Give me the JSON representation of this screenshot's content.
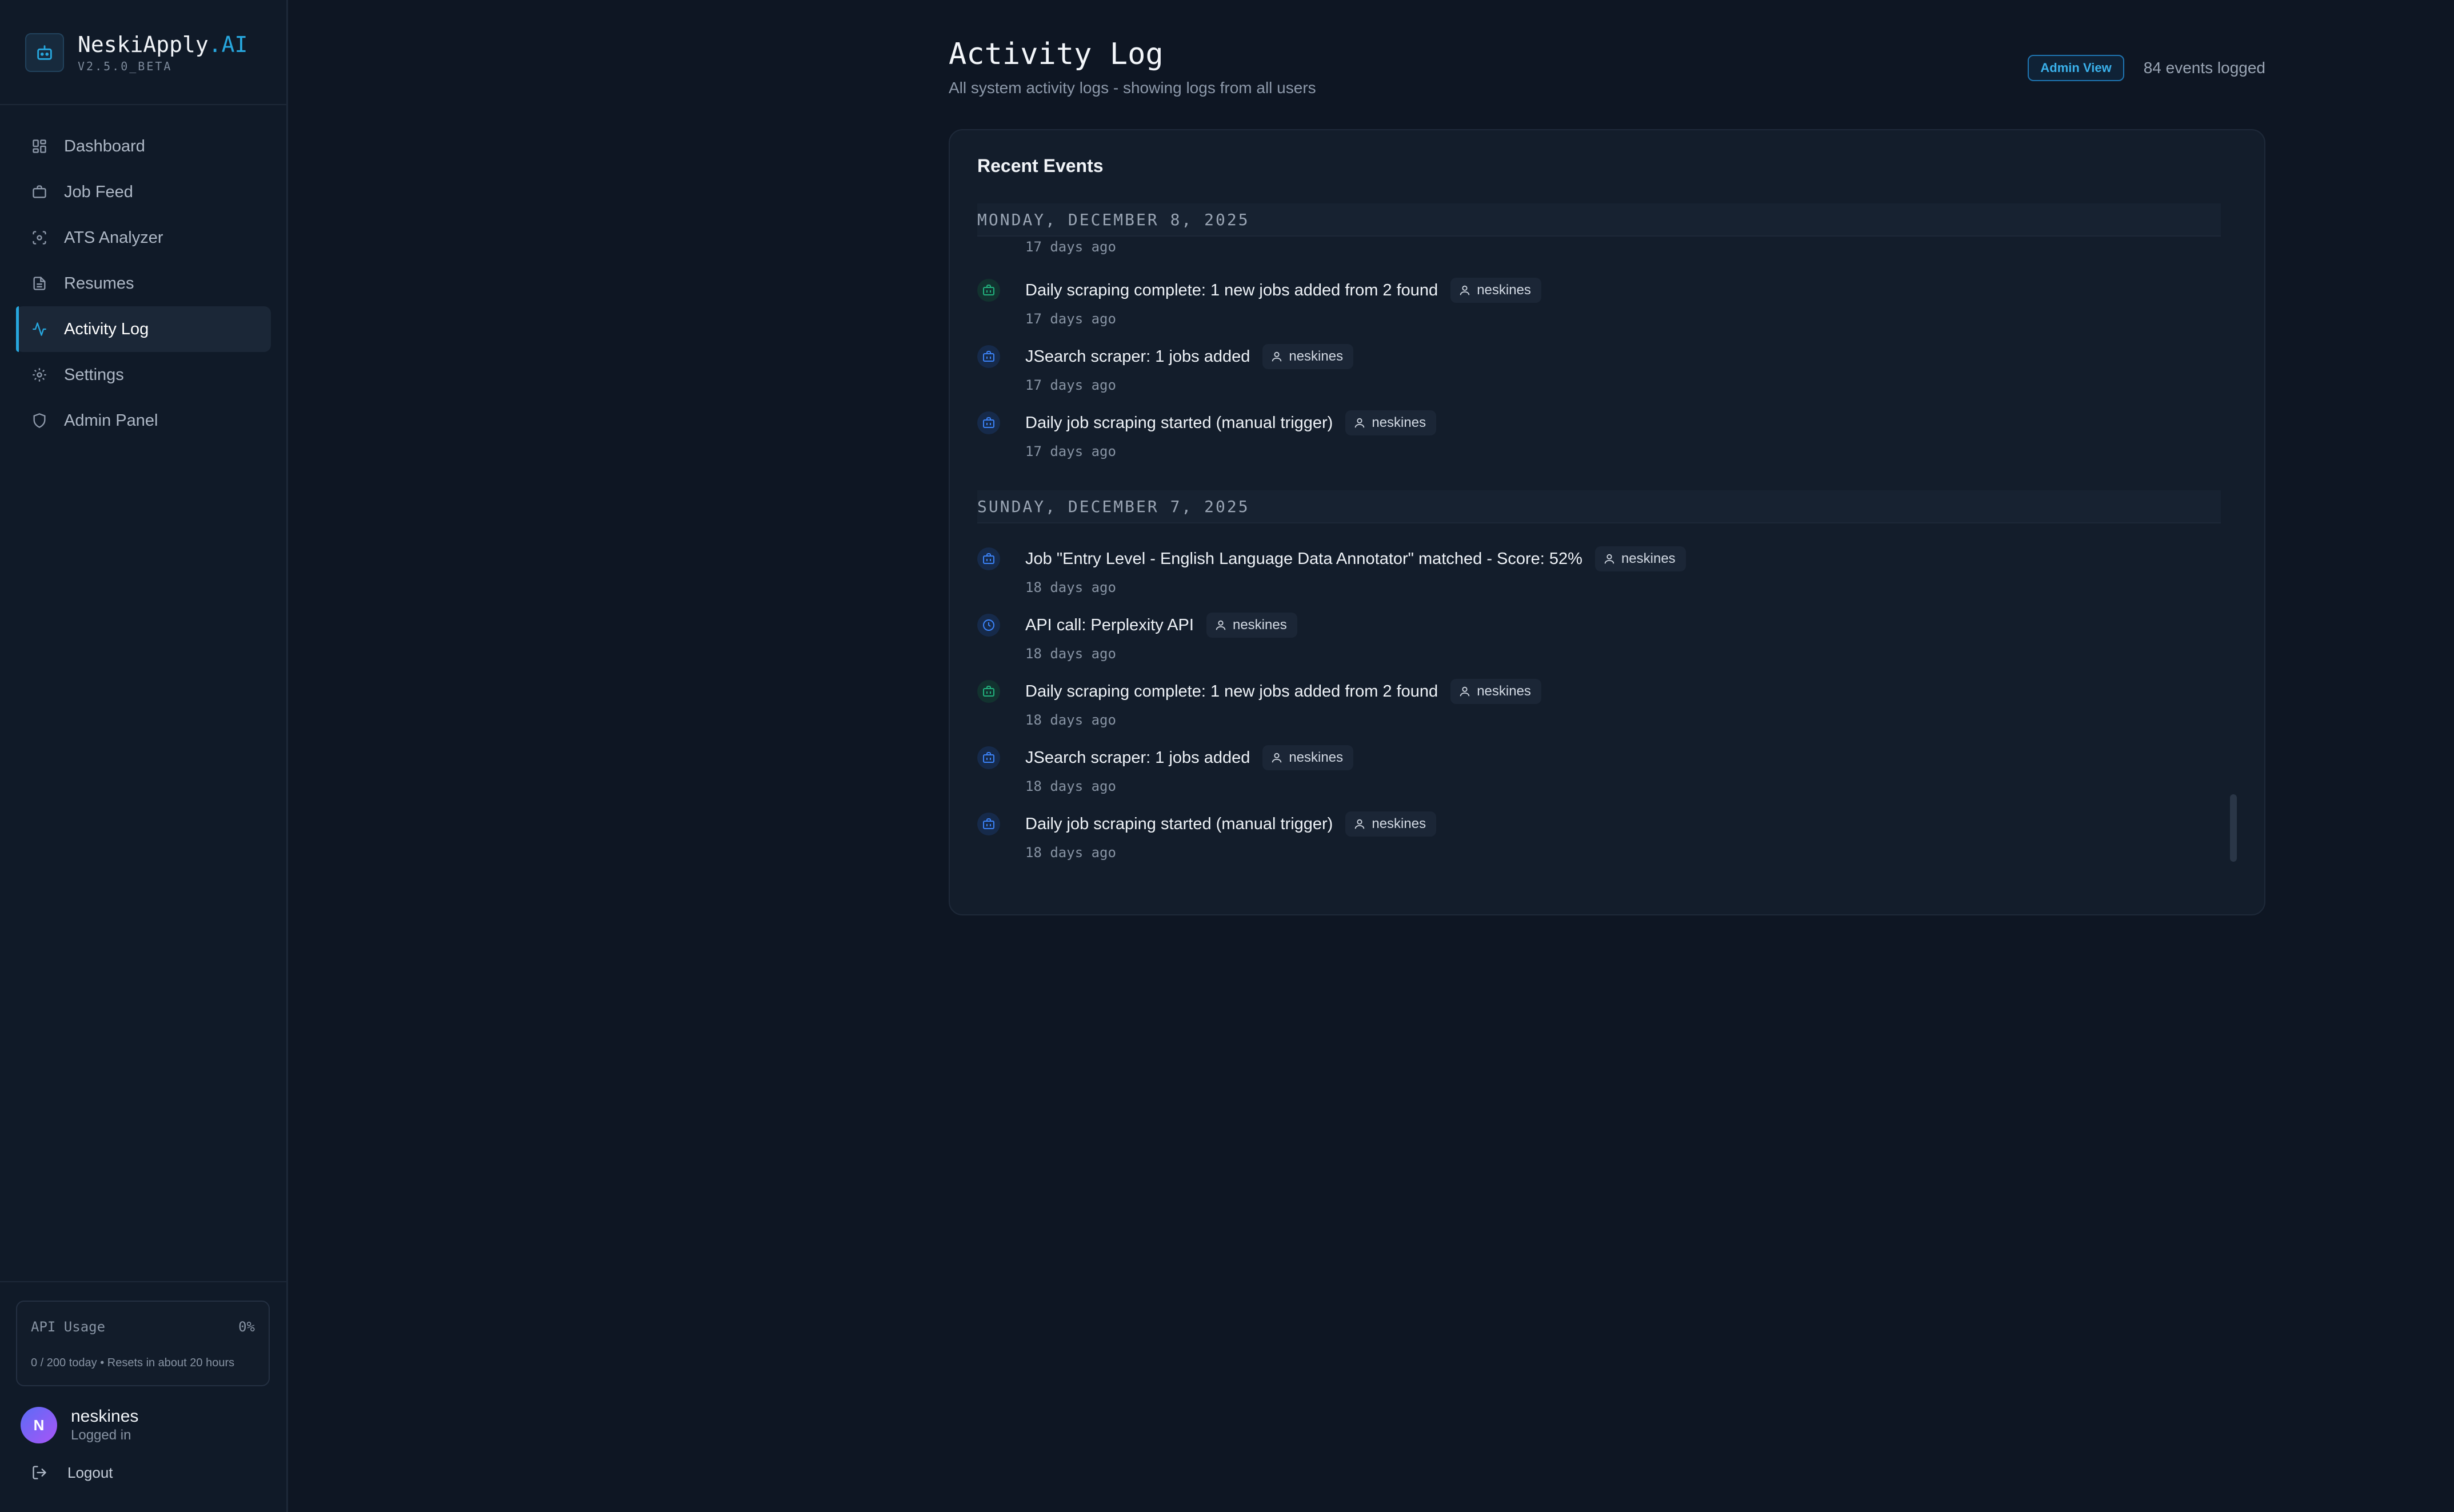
{
  "brand": {
    "name": "NeskiApply",
    "suffix": ".AI",
    "version": "V2.5.0_BETA"
  },
  "nav": [
    {
      "label": "Dashboard",
      "icon": "dashboard-icon"
    },
    {
      "label": "Job Feed",
      "icon": "briefcase-icon"
    },
    {
      "label": "ATS Analyzer",
      "icon": "scan-icon"
    },
    {
      "label": "Resumes",
      "icon": "document-icon"
    },
    {
      "label": "Activity Log",
      "icon": "activity-icon",
      "active": true
    },
    {
      "label": "Settings",
      "icon": "gear-icon"
    },
    {
      "label": "Admin Panel",
      "icon": "shield-icon"
    }
  ],
  "usage": {
    "title": "API Usage",
    "percent": "0%",
    "detail": "0 / 200 today • Resets in about 20 hours"
  },
  "user": {
    "initial": "N",
    "name": "neskines",
    "status": "Logged in"
  },
  "logout_label": "Logout",
  "header": {
    "title": "Activity Log",
    "subtitle": "All system activity logs - showing logs from all users",
    "badge": "Admin View",
    "count": "84 events logged"
  },
  "card": {
    "title": "Recent Events",
    "groups": [
      {
        "date": "MONDAY, DECEMBER 8, 2025",
        "leading_time": "17 days ago",
        "events": [
          {
            "title": "Daily scraping complete: 1 new jobs added from 2 found",
            "user": "neskines",
            "time": "17 days ago",
            "icon": "briefcase-icon",
            "color": "#22b07d"
          },
          {
            "title": "JSearch scraper: 1 jobs added",
            "user": "neskines",
            "time": "17 days ago",
            "icon": "briefcase-icon",
            "color": "#3b82f6"
          },
          {
            "title": "Daily job scraping started (manual trigger)",
            "user": "neskines",
            "time": "17 days ago",
            "icon": "briefcase-icon",
            "color": "#3b82f6"
          }
        ]
      },
      {
        "date": "SUNDAY, DECEMBER 7, 2025",
        "events": [
          {
            "title": "Job \"Entry Level - English Language Data Annotator\" matched - Score: 52%",
            "user": "neskines",
            "time": "18 days ago",
            "icon": "briefcase-icon",
            "color": "#3b82f6"
          },
          {
            "title": "API call: Perplexity API",
            "user": "neskines",
            "time": "18 days ago",
            "icon": "clock-icon",
            "color": "#3b82f6"
          },
          {
            "title": "Daily scraping complete: 1 new jobs added from 2 found",
            "user": "neskines",
            "time": "18 days ago",
            "icon": "briefcase-icon",
            "color": "#22b07d"
          },
          {
            "title": "JSearch scraper: 1 jobs added",
            "user": "neskines",
            "time": "18 days ago",
            "icon": "briefcase-icon",
            "color": "#3b82f6"
          },
          {
            "title": "Daily job scraping started (manual trigger)",
            "user": "neskines",
            "time": "18 days ago",
            "icon": "briefcase-icon",
            "color": "#3b82f6"
          }
        ]
      }
    ]
  }
}
